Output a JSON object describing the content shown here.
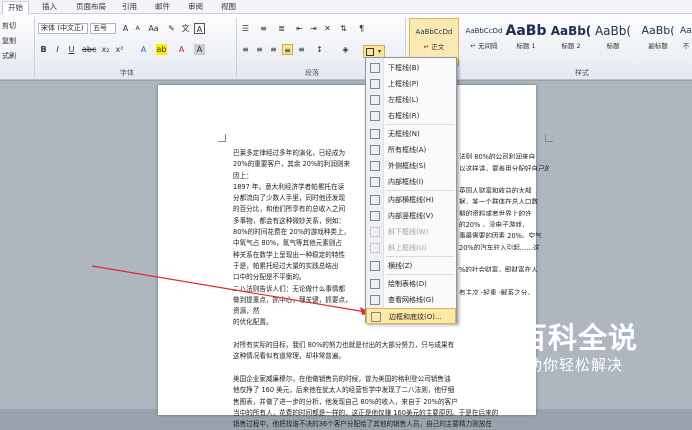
{
  "tabs": [
    "开始",
    "插入",
    "页面布局",
    "引用",
    "邮件",
    "审阅",
    "视图"
  ],
  "clipboard": {
    "cut": "剪切",
    "copy": "复制",
    "format_painter": "式刷"
  },
  "font": {
    "family": "宋体 (中文正)",
    "size": "五号",
    "group_label": "字体"
  },
  "paragraph": {
    "group_label": "段落"
  },
  "styles": {
    "group_label": "样式",
    "items": [
      {
        "sample": "AaBbCcDd",
        "name": "↵ 正文"
      },
      {
        "sample": "AaBbCcDd",
        "name": "↵ 无间隔"
      },
      {
        "sample": "AaBb",
        "name": "标题 1"
      },
      {
        "sample": "AaBb(",
        "name": "标题 2"
      },
      {
        "sample": "AaBb(",
        "name": "标题"
      },
      {
        "sample": "AaBb(",
        "name": "副标题"
      },
      {
        "sample": "AaBbC",
        "name": "不"
      }
    ]
  },
  "border_menu": {
    "items": [
      {
        "label": "下框线(B)",
        "enabled": true
      },
      {
        "label": "上框线(P)",
        "enabled": true
      },
      {
        "label": "左框线(L)",
        "enabled": true
      },
      {
        "label": "右框线(R)",
        "enabled": true
      },
      {
        "label": "无框线(N)",
        "enabled": true,
        "sep": true
      },
      {
        "label": "所有框线(A)",
        "enabled": true
      },
      {
        "label": "外侧框线(S)",
        "enabled": true
      },
      {
        "label": "内部框线(I)",
        "enabled": true
      },
      {
        "label": "内部横框线(H)",
        "enabled": true,
        "sep": true
      },
      {
        "label": "内部竖框线(V)",
        "enabled": true
      },
      {
        "label": "斜下框线(W)",
        "enabled": false
      },
      {
        "label": "斜上框线(U)",
        "enabled": false
      },
      {
        "label": "横线(Z)",
        "enabled": true,
        "sep": true
      },
      {
        "label": "绘制表格(D)",
        "enabled": true,
        "sep": true
      },
      {
        "label": "查看网格线(G)",
        "enabled": true
      },
      {
        "label": "边框和底纹(O)...",
        "enabled": true,
        "highlight": true
      }
    ]
  },
  "document": {
    "lines": [
      "巴莱多定律经过多年的演化，已经成为",
      "法则 80%的公司利润来自",
      "20%的重要客户，其余 20%的利润则来",
      "以这样讲，要善用分配好自己的",
      "因上：",
      "",
      "1897 年，意大利经济学者帕累托在读",
      "英国人财富和收益的大部",
      "分都流向了少数人手里，同时他还发现",
      "据，某一个群体在总人口数",
      "的百分比，和他们所享有的总收入之间",
      "期的资料或者世界上的许",
      "多事物，都会有这种微妙关系，例如：",
      "的20% 。没电子游戏，",
      "80%的时间花费在 20%的游戏种类上，",
      "事最需要的因素 20%。空气",
      "中氧气占 80%，氮气等其他元素则占",
      "20%的汽车驻入引起……这",
      "种关系在数学上呈现出一种稳定的特性",
      "",
      "于是，帕累托经过大量的实践总结出",
      "%的社会财富，即财富在人",
      "口中的分配是不平衡的。",
      "",
      "二八法则告诉人们：无论做什么事情都",
      "有主次 -轻重 -解系之分，",
      "做到提重点，抓中心，理关键，抓要点，",
      "资源，然",
      "的优化配置。",
      "",
      "对所有实际的目标，我们 80%的努力也就是付出的大部分努力，只与成果有",
      "这种情况看似有道常理，却非常普遍。",
      "",
      "美国企业家威廉穆尔，在他做销售员的时候，曾为美国的格利登公司销售油",
      "他仅挣了 160 美元，后来他在犹太人的经营哲学中发现了二八法则，他仔细",
      "售图表，并做了进一步的分析，他发现自己 80%的收入，来自于 20%的客户",
      "当中的所有人，花费的时间都是一样的，这正是他仅赚 160美元的主要原因。于是在后来的",
      "销售过程中，他把找谁不决的36个客户分配给了其他的销售人员，自己的主要精力则放在"
    ]
  },
  "watermark": {
    "title": "百科全说",
    "subtitle": "助你轻松解决"
  }
}
